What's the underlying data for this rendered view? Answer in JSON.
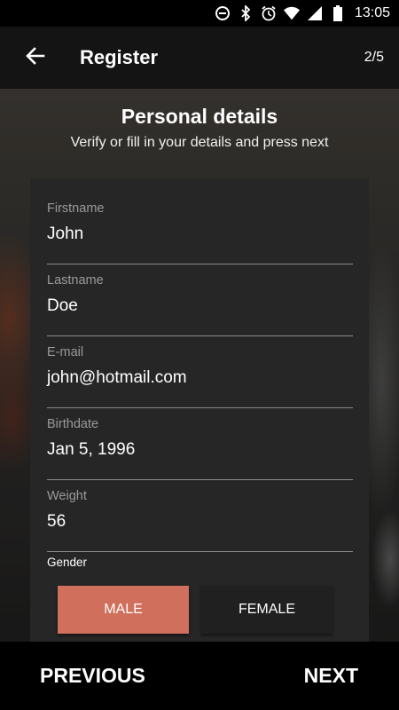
{
  "status_bar": {
    "time": "13:05",
    "icons": [
      "dnd-icon",
      "bluetooth-icon",
      "alarm-icon",
      "wifi-icon",
      "signal-icon",
      "battery-icon"
    ]
  },
  "app_bar": {
    "title": "Register",
    "step": "2/5",
    "back_icon": "arrow-left-icon"
  },
  "header": {
    "title": "Personal details",
    "subtitle": "Verify or fill in your details and press next"
  },
  "form": {
    "fields": [
      {
        "label": "Firstname",
        "value": "John"
      },
      {
        "label": "Lastname",
        "value": "Doe"
      },
      {
        "label": "E-mail",
        "value": "john@hotmail.com"
      },
      {
        "label": "Birthdate",
        "value": "Jan 5, 1996"
      },
      {
        "label": "Weight",
        "value": "56"
      }
    ],
    "gender": {
      "label": "Gender",
      "options": [
        "MALE",
        "FEMALE"
      ],
      "selected": "MALE"
    }
  },
  "footer": {
    "previous": "PREVIOUS",
    "next": "NEXT"
  },
  "colors": {
    "accent": "#d0705c",
    "card": "#262626",
    "bar": "#000000"
  }
}
